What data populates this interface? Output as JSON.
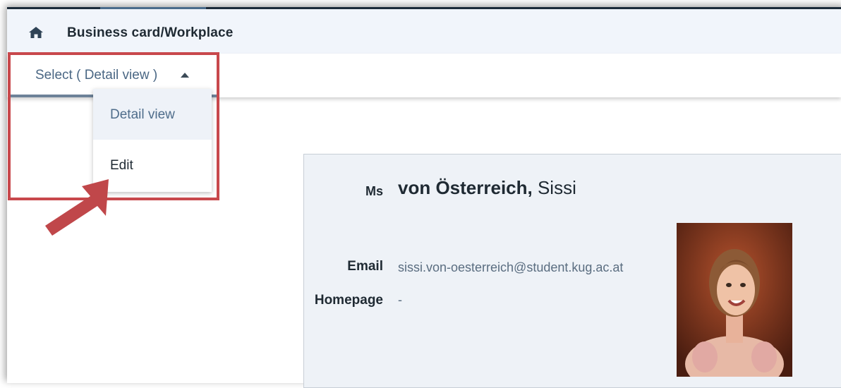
{
  "header": {
    "title": "Business card/Workplace",
    "home_icon": "home-icon"
  },
  "toolbar": {
    "select_label": "Select ( Detail view )"
  },
  "dropdown": {
    "items": [
      {
        "label": "Detail view",
        "active": true
      },
      {
        "label": "Edit",
        "active": false
      }
    ]
  },
  "card": {
    "salutation": "Ms",
    "last_name": "von Österreich,",
    "first_name": "Sissi",
    "email_label": "Email",
    "email_value": "sissi.von-oesterreich@student.kug.ac.at",
    "homepage_label": "Homepage",
    "homepage_value": "-"
  },
  "colors": {
    "highlight": "#c8484c",
    "arrow": "#c0474a",
    "accent": "#4a6784"
  }
}
